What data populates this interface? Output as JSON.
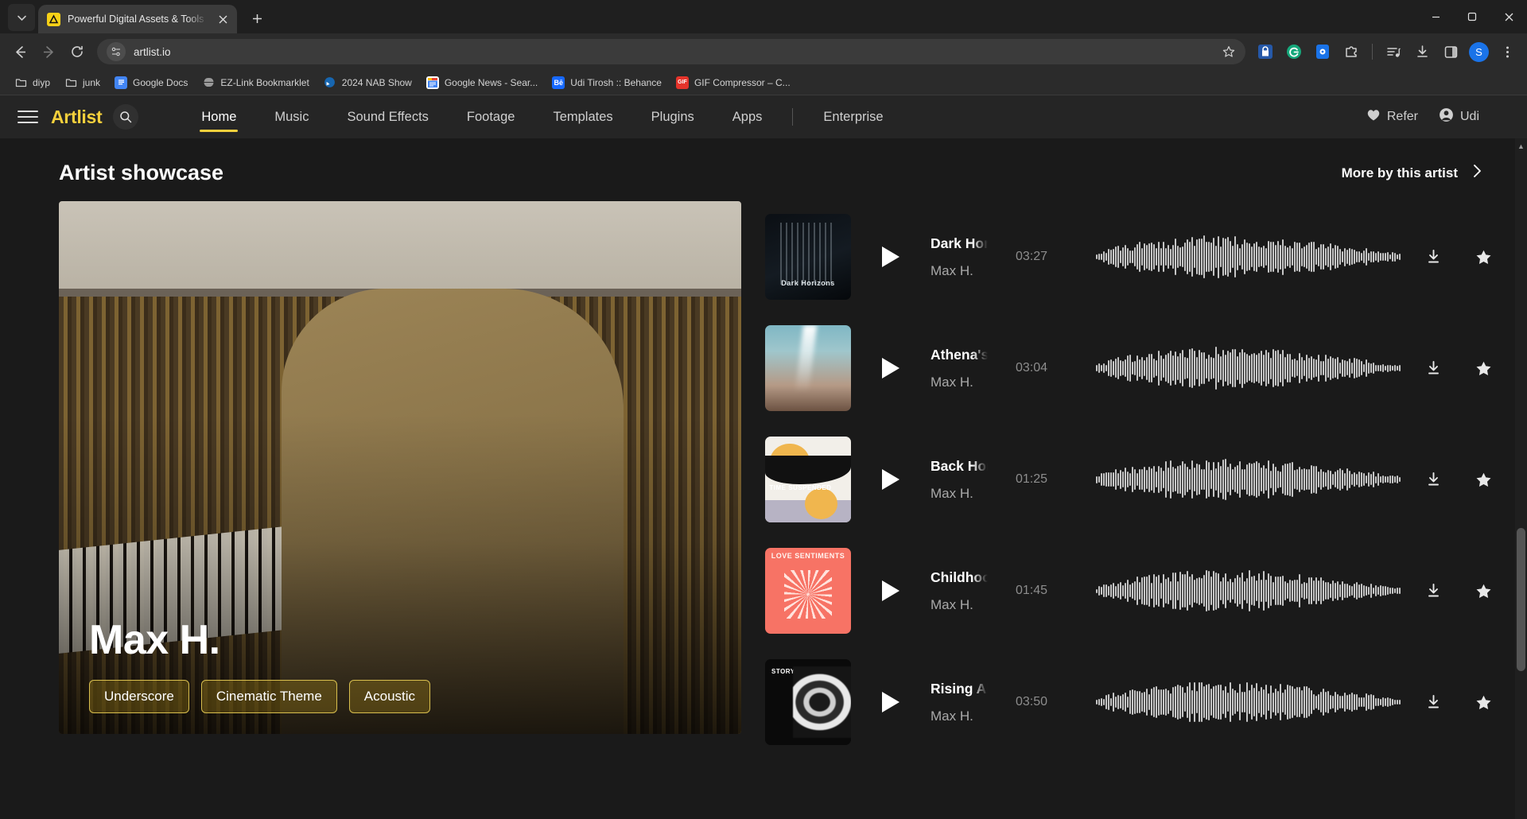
{
  "browser": {
    "tab": {
      "title": "Powerful Digital Assets & Tools",
      "favicon": "artlist-triangle-icon"
    },
    "new_tab_label": "+",
    "url": "artlist.io",
    "window_controls": {
      "minimize": "–",
      "maximize": "▢",
      "close": "✕"
    },
    "toolbar_icons": [
      "back-icon",
      "forward-icon",
      "reload-icon",
      "site-settings-icon",
      "bookmark-star-icon",
      "lastpass-extension-icon",
      "grammarly-extension-icon",
      "extension-blue-icon",
      "extensions-puzzle-icon",
      "media-playlist-icon",
      "downloads-icon",
      "side-panel-icon",
      "profile-avatar",
      "chrome-menu-icon"
    ],
    "profile_initial": "S",
    "bookmarks": [
      {
        "label": "diyp",
        "icon": "folder-icon"
      },
      {
        "label": "junk",
        "icon": "folder-icon"
      },
      {
        "label": "Google Docs",
        "icon": "google-docs-icon"
      },
      {
        "label": "EZ-Link Bookmarklet",
        "icon": "globe-icon"
      },
      {
        "label": "2024 NAB Show",
        "icon": "nab-show-icon"
      },
      {
        "label": "Google News - Sear...",
        "icon": "google-news-icon"
      },
      {
        "label": "Udi Tirosh :: Behance",
        "icon": "behance-icon"
      },
      {
        "label": "GIF Compressor – C...",
        "icon": "gif-icon"
      }
    ]
  },
  "site": {
    "brand": "Artlist",
    "brand_first_letter": "A",
    "nav_links": [
      {
        "label": "Home",
        "active": true
      },
      {
        "label": "Music",
        "active": false
      },
      {
        "label": "Sound Effects",
        "active": false
      },
      {
        "label": "Footage",
        "active": false
      },
      {
        "label": "Templates",
        "active": false
      },
      {
        "label": "Plugins",
        "active": false
      },
      {
        "label": "Apps",
        "active": false
      }
    ],
    "enterprise_label": "Enterprise",
    "refer_label": "Refer",
    "account_label": "Udi",
    "accent_color": "#f5d03c"
  },
  "section": {
    "title": "Artist showcase",
    "more_link": "More by this artist"
  },
  "hero": {
    "artist_name": "Max H.",
    "tags": [
      "Underscore",
      "Cinematic Theme",
      "Acoustic"
    ]
  },
  "tracks": [
    {
      "title": "Dark Hor",
      "artist": "Max H.",
      "duration": "03:27",
      "art_caption": "Dark Horizons"
    },
    {
      "title": "Athena's",
      "artist": "Max H.",
      "duration": "03:04",
      "art_caption": ""
    },
    {
      "title": "Back Hor",
      "artist": "Max H.",
      "duration": "01:25",
      "art_caption": "TIME SUSPENDED"
    },
    {
      "title": "Childhoo",
      "artist": "Max H.",
      "duration": "01:45",
      "art_caption": "LOVE SENTIMENTS"
    },
    {
      "title": "Rising Ab",
      "artist": "Max H.",
      "duration": "03:50",
      "art_caption": "STORY OF A HERO"
    }
  ],
  "track_actions": [
    "download-icon",
    "favorite-star-icon",
    "more-options-icon"
  ]
}
